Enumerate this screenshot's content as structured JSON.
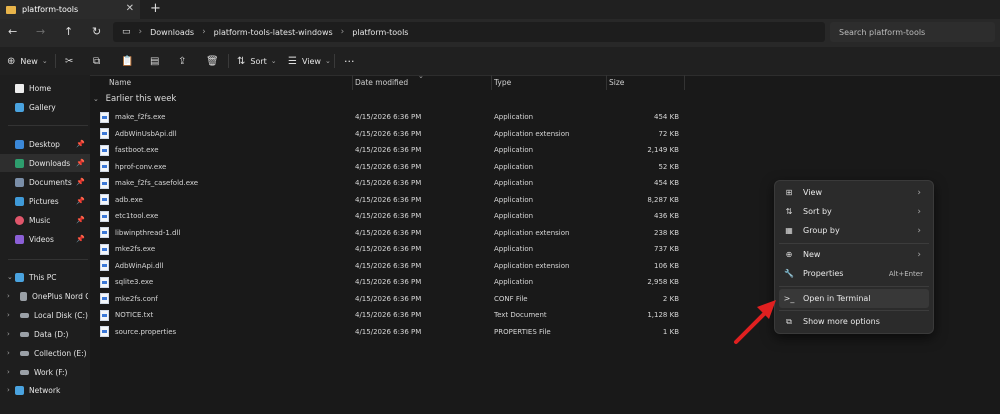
{
  "window": {
    "tab_title": "platform-tools"
  },
  "nav": {
    "breadcrumbs": [
      "Downloads",
      "platform-tools-latest-windows",
      "platform-tools"
    ],
    "search_placeholder": "Search platform-tools"
  },
  "toolbar": {
    "new_label": "New",
    "sort_label": "Sort",
    "view_label": "View",
    "more": "···"
  },
  "sidebar": {
    "items": [
      {
        "label": "Home",
        "icon": "home-icon",
        "color": "#f2f2f2"
      },
      {
        "label": "Gallery",
        "icon": "gallery-icon",
        "color": "#4aa3df"
      },
      {
        "label": "Desktop",
        "icon": "desktop-icon",
        "color": "#3b88d8"
      },
      {
        "label": "Downloads",
        "icon": "downloads-icon",
        "color": "#2e9e6e"
      },
      {
        "label": "Documents",
        "icon": "documents-icon",
        "color": "#7a8ea8"
      },
      {
        "label": "Pictures",
        "icon": "pictures-icon",
        "color": "#3f9ad8"
      },
      {
        "label": "Music",
        "icon": "music-icon",
        "color": "#e0566b"
      },
      {
        "label": "Videos",
        "icon": "videos-icon",
        "color": "#8b5fd6"
      },
      {
        "label": "This PC",
        "icon": "this-pc-icon",
        "color": "#4aa3df"
      },
      {
        "label": "OnePlus Nord CE",
        "icon": "phone-icon",
        "color": "#9aa0a6"
      },
      {
        "label": "Local Disk (C:)",
        "icon": "drive-icon",
        "color": "#9aa0a6"
      },
      {
        "label": "Data (D:)",
        "icon": "drive-icon",
        "color": "#9aa0a6"
      },
      {
        "label": "Collection (E:)",
        "icon": "drive-icon",
        "color": "#9aa0a6"
      },
      {
        "label": "Work (F:)",
        "icon": "drive-icon",
        "color": "#9aa0a6"
      },
      {
        "label": "Network",
        "icon": "network-icon",
        "color": "#4aa3df"
      }
    ]
  },
  "columns": {
    "name": "Name",
    "date": "Date modified",
    "type": "Type",
    "size": "Size"
  },
  "group_label": "Earlier this week",
  "files": [
    {
      "name": "make_f2fs.exe",
      "date": "4/15/2026 6:36 PM",
      "type": "Application",
      "size": "454 KB"
    },
    {
      "name": "AdbWinUsbApi.dll",
      "date": "4/15/2026 6:36 PM",
      "type": "Application extension",
      "size": "72 KB"
    },
    {
      "name": "fastboot.exe",
      "date": "4/15/2026 6:36 PM",
      "type": "Application",
      "size": "2,149 KB"
    },
    {
      "name": "hprof-conv.exe",
      "date": "4/15/2026 6:36 PM",
      "type": "Application",
      "size": "52 KB"
    },
    {
      "name": "make_f2fs_casefold.exe",
      "date": "4/15/2026 6:36 PM",
      "type": "Application",
      "size": "454 KB"
    },
    {
      "name": "adb.exe",
      "date": "4/15/2026 6:36 PM",
      "type": "Application",
      "size": "8,287 KB"
    },
    {
      "name": "etc1tool.exe",
      "date": "4/15/2026 6:36 PM",
      "type": "Application",
      "size": "436 KB"
    },
    {
      "name": "libwinpthread-1.dll",
      "date": "4/15/2026 6:36 PM",
      "type": "Application extension",
      "size": "238 KB"
    },
    {
      "name": "mke2fs.exe",
      "date": "4/15/2026 6:36 PM",
      "type": "Application",
      "size": "737 KB"
    },
    {
      "name": "AdbWinApi.dll",
      "date": "4/15/2026 6:36 PM",
      "type": "Application extension",
      "size": "106 KB"
    },
    {
      "name": "sqlite3.exe",
      "date": "4/15/2026 6:36 PM",
      "type": "Application",
      "size": "2,958 KB"
    },
    {
      "name": "mke2fs.conf",
      "date": "4/15/2026 6:36 PM",
      "type": "CONF File",
      "size": "2 KB"
    },
    {
      "name": "NOTICE.txt",
      "date": "4/15/2026 6:36 PM",
      "type": "Text Document",
      "size": "1,128 KB"
    },
    {
      "name": "source.properties",
      "date": "4/15/2026 6:36 PM",
      "type": "PROPERTIES File",
      "size": "1 KB"
    }
  ],
  "context_menu": {
    "view": "View",
    "sort_by": "Sort by",
    "group_by": "Group by",
    "new": "New",
    "properties": "Properties",
    "properties_shortcut": "Alt+Enter",
    "open_terminal": "Open in Terminal",
    "show_more": "Show more options"
  },
  "colors": {
    "accent": "#4aa3df",
    "arrow": "#e02020",
    "folder": "#e8b44a"
  }
}
